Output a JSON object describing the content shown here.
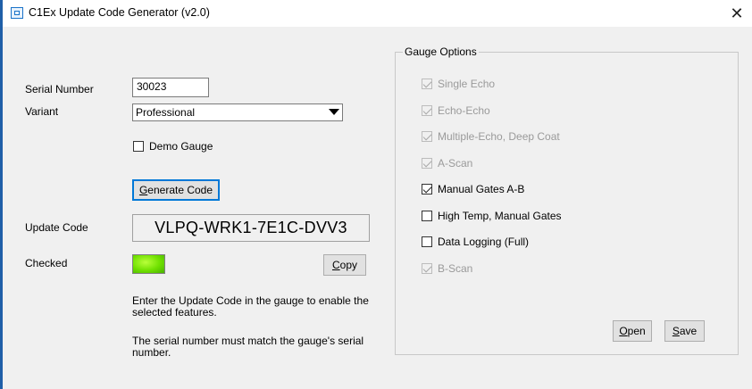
{
  "window": {
    "title": "C1Ex Update Code Generator (v2.0)",
    "close_symbol": "✕"
  },
  "left": {
    "serial_label": "Serial Number",
    "serial_value": "30023",
    "variant_label": "Variant",
    "variant_value": "Professional",
    "demo_label": "Demo Gauge",
    "demo_checked": false,
    "generate_label": "Generate Code",
    "update_label": "Update Code",
    "update_code": "VLPQ-WRK1-7E1C-DVV3",
    "checked_label": "Checked",
    "checked_indicator_color": "#6fe000",
    "copy_label": "Copy",
    "info_line1": "Enter the Update Code in the gauge to enable the selected features.",
    "info_line2": "The serial number must match the gauge's serial number."
  },
  "gauge_options": {
    "title": "Gauge Options",
    "items": [
      {
        "label": "Single Echo",
        "checked": true,
        "enabled": false
      },
      {
        "label": "Echo-Echo",
        "checked": true,
        "enabled": false
      },
      {
        "label": "Multiple-Echo, Deep Coat",
        "checked": true,
        "enabled": false
      },
      {
        "label": "A-Scan",
        "checked": true,
        "enabled": false
      },
      {
        "label": "Manual Gates A-B",
        "checked": true,
        "enabled": true
      },
      {
        "label": "High Temp, Manual Gates",
        "checked": false,
        "enabled": true
      },
      {
        "label": "Data Logging (Full)",
        "checked": false,
        "enabled": true
      },
      {
        "label": "B-Scan",
        "checked": true,
        "enabled": false
      }
    ],
    "open_label": "Open",
    "save_label": "Save"
  }
}
